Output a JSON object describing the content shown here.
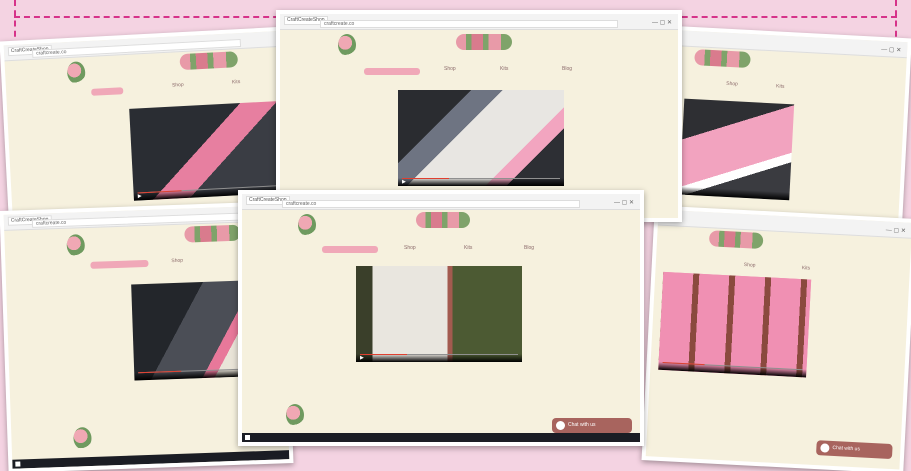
{
  "browser": {
    "tab_label": "CraftCreateShop",
    "address": "craftcreate.co"
  },
  "site": {
    "nav_items": [
      "Home",
      "Shop",
      "Kits",
      "Blog"
    ]
  },
  "chat_widget": {
    "label": "Chat with us"
  },
  "screens": [
    {
      "id": "top-left",
      "video": "acetate sheet on embossing folder"
    },
    {
      "id": "top-center",
      "video": "card panel on platform"
    },
    {
      "id": "top-right",
      "video": "pink card stock"
    },
    {
      "id": "bottom-left",
      "video": "trimming a card panel"
    },
    {
      "id": "bottom-center",
      "video": "finished card"
    },
    {
      "id": "bottom-right",
      "video": "pink panels with doily"
    }
  ]
}
